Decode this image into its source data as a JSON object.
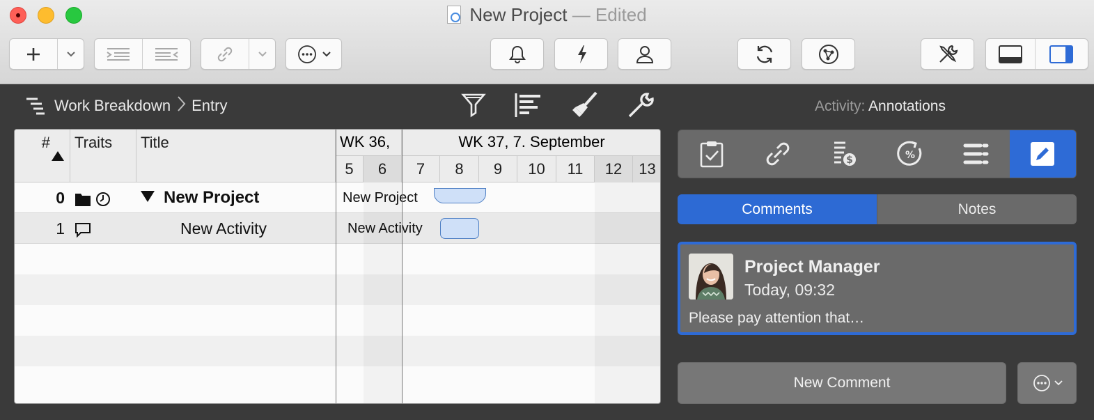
{
  "window": {
    "title": "New Project",
    "edited_suffix": " — Edited"
  },
  "toolbar": {
    "add_icon": "plus-icon",
    "indent_icon": "indent-icon",
    "outdent_icon": "outdent-icon",
    "link_icon": "link-icon",
    "more_icon": "ellipsis-icon",
    "alarm_icon": "bell-icon",
    "quick_icon": "lightning-icon",
    "resource_icon": "person-icon",
    "refresh_icon": "refresh-icon",
    "network_icon": "network-icon",
    "tools_icon": "tools-icon",
    "bottom_panel_icon": "bottom-panel-icon",
    "right_panel_icon": "right-panel-icon"
  },
  "breadcrumb": {
    "root": "Work Breakdown",
    "leaf": "Entry"
  },
  "activity": {
    "label": "Activity:",
    "value": "Annotations"
  },
  "table": {
    "headers": {
      "num": "#",
      "traits": "Traits",
      "title": "Title"
    },
    "weeks": [
      "WK 36,",
      "WK 37, 7. September"
    ],
    "days": [
      "5",
      "6",
      "7",
      "8",
      "9",
      "10",
      "11",
      "12",
      "13"
    ],
    "rows": [
      {
        "num": "0",
        "title": "New Project",
        "bar_label": "New Project",
        "summary": true
      },
      {
        "num": "1",
        "title": "New Activity",
        "bar_label": "New Activity",
        "summary": false
      }
    ]
  },
  "inspector": {
    "tabs": [
      "clipboard-check-icon",
      "link-icon",
      "cost-icon",
      "percent-icon",
      "list-icon",
      "pencil-icon"
    ],
    "segments": {
      "comments": "Comments",
      "notes": "Notes"
    },
    "comment": {
      "author": "Project Manager",
      "time": "Today, 09:32",
      "text": "Please pay attention that…"
    },
    "new_comment_label": "New Comment"
  },
  "colors": {
    "accent": "#2e6bd6",
    "bar_fill": "#cfe0f8",
    "bar_stroke": "#4e7fc4"
  }
}
